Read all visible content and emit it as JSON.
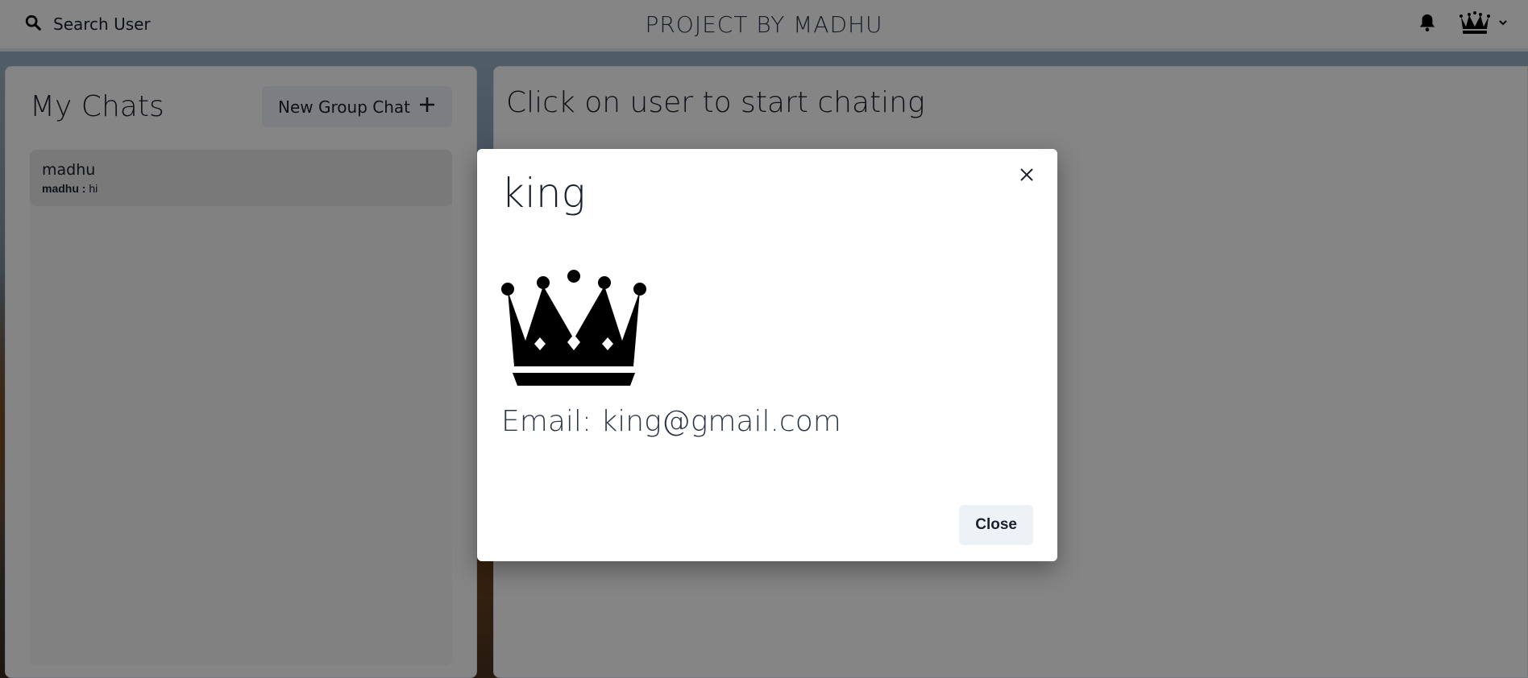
{
  "header": {
    "search_label": "Search User",
    "app_title": "PROJECT BY MADHU",
    "search_icon": "search-icon",
    "bell_icon": "bell-icon",
    "avatar_icon": "crown-icon",
    "chevron_icon": "chevron-down-icon"
  },
  "sidebar": {
    "title": "My Chats",
    "new_group_label": "New Group Chat",
    "chats": [
      {
        "name": "madhu",
        "sender": "madhu :",
        "message": "hi"
      }
    ]
  },
  "main": {
    "placeholder": "Click on user to start chating"
  },
  "modal": {
    "title": "king",
    "email": "Email: king@gmail.com",
    "close_label": "Close",
    "avatar_icon": "crown-icon"
  },
  "colors": {
    "overlay": "#000000",
    "button_bg": "#edf2f7",
    "chat_item_bg": "#e8e8e8"
  }
}
